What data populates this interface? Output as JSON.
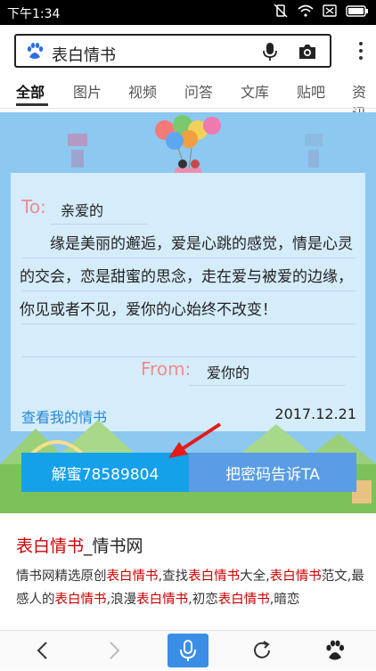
{
  "status": {
    "time": "下午1:34"
  },
  "search": {
    "query": "表白情书"
  },
  "tabs": [
    "全部",
    "图片",
    "视频",
    "问答",
    "文库",
    "贴吧",
    "资讯"
  ],
  "card": {
    "to_label": "To:",
    "to_name": "亲爱的",
    "body": "缘是美丽的邂逅，爱是心跳的感觉，情是心灵的交会，恋是甜蜜的思念，走在爱与被爱的边缘，你见或者不见，爱你的心始终不改变！",
    "from_label": "From:",
    "from_name": "爱你的",
    "view_link": "查看我的情书",
    "date": "2017.12.21",
    "unlock_button": "解蜜78589804",
    "share_button": "把密码告诉TA"
  },
  "result": {
    "title_kw": "表白情书",
    "title_rest": "_情书网",
    "desc": [
      {
        "t": "情书网精选原创",
        "k": false
      },
      {
        "t": "表白情书",
        "k": true
      },
      {
        "t": ",查找",
        "k": false
      },
      {
        "t": "表白情书",
        "k": true
      },
      {
        "t": "大全,",
        "k": false
      },
      {
        "t": "表白情书",
        "k": true
      },
      {
        "t": "范文,最感人的",
        "k": false
      },
      {
        "t": "表白情书",
        "k": true
      },
      {
        "t": ",浪漫",
        "k": false
      },
      {
        "t": "表白情书",
        "k": true
      },
      {
        "t": ",初恋",
        "k": false
      },
      {
        "t": "表白情书",
        "k": true
      },
      {
        "t": ",暗恋",
        "k": false
      }
    ]
  },
  "colors": {
    "accent": "#15a0ea",
    "keyword": "#cc0000",
    "sky": "#8cc8f0"
  }
}
